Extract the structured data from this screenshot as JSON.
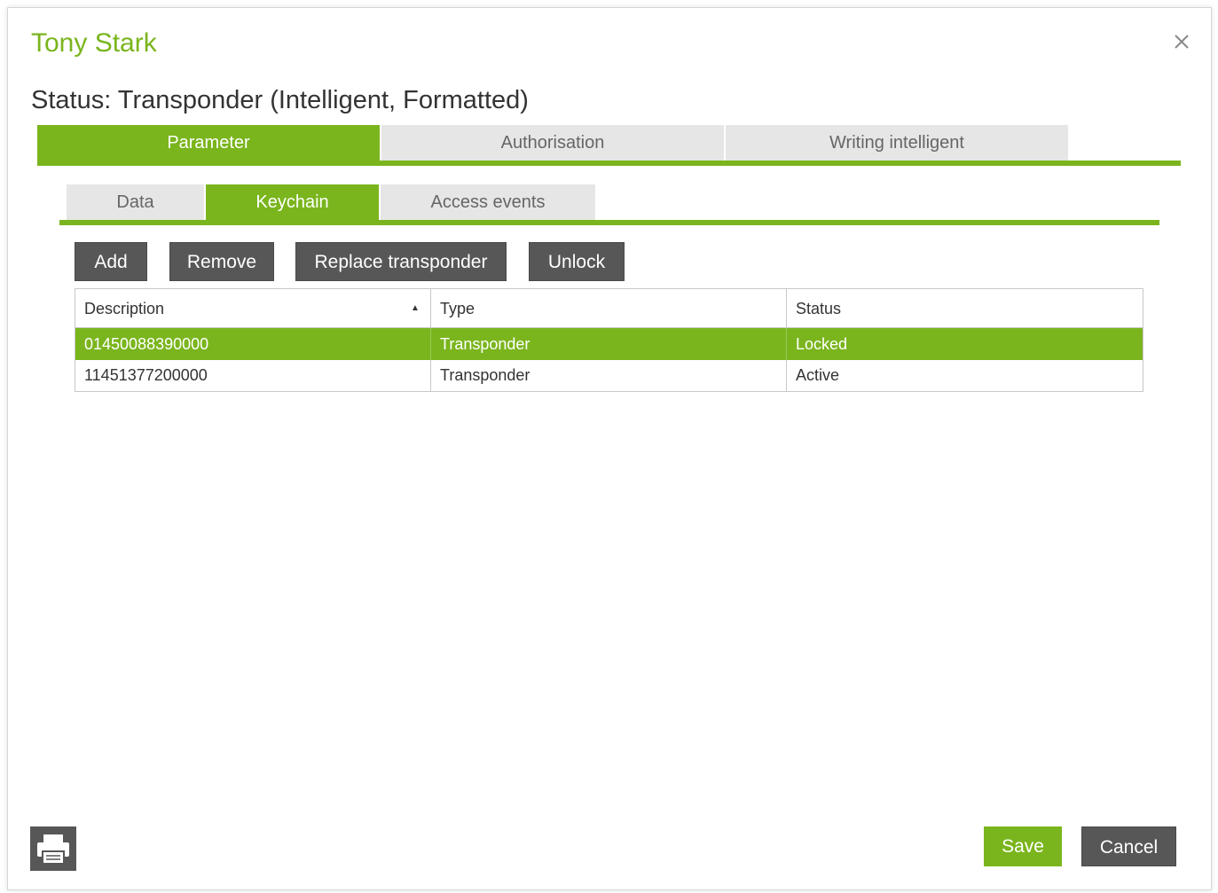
{
  "dialog": {
    "title": "Tony Stark",
    "close_icon": "close-icon",
    "status_heading": "Status: Transponder (Intelligent, Formatted)"
  },
  "main_tabs": [
    {
      "label": "Parameter",
      "active": true
    },
    {
      "label": "Authorisation",
      "active": false
    },
    {
      "label": "Writing intelligent",
      "active": false
    }
  ],
  "sub_tabs": [
    {
      "label": "Data",
      "active": false
    },
    {
      "label": "Keychain",
      "active": true
    },
    {
      "label": "Access events",
      "active": false
    }
  ],
  "toolbar": {
    "add_label": "Add",
    "remove_label": "Remove",
    "replace_label": "Replace transponder",
    "unlock_label": "Unlock"
  },
  "grid": {
    "columns": [
      "Description",
      "Type",
      "Status"
    ],
    "sort_icon": "sort-ascending-icon",
    "rows": [
      {
        "description": "01450088390000",
        "type": "Transponder",
        "status": "Locked",
        "selected": true
      },
      {
        "description": "11451377200000",
        "type": "Transponder",
        "status": "Active",
        "selected": false
      }
    ]
  },
  "footer": {
    "print_icon": "printer-icon",
    "save_label": "Save",
    "cancel_label": "Cancel"
  },
  "colors": {
    "accent": "#7ab51d",
    "dark_button": "#575757",
    "inactive_tab": "#e6e6e6"
  }
}
